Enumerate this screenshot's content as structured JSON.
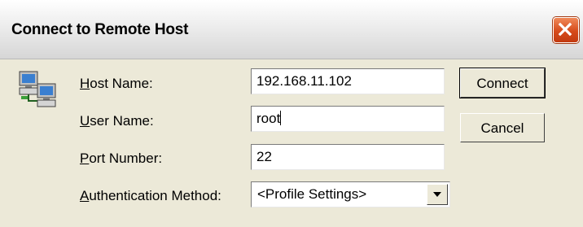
{
  "window": {
    "title": "Connect to Remote Host"
  },
  "form": {
    "host_name_label_acc": "H",
    "host_name_label_rest": "ost Name:",
    "host_name_value": "192.168.11.102",
    "user_name_label_acc": "U",
    "user_name_label_rest": "ser Name:",
    "user_name_value": "root",
    "port_label_acc": "P",
    "port_label_rest": "ort Number:",
    "port_value": "22",
    "auth_label_acc": "A",
    "auth_label_rest": "uthentication Method:",
    "auth_value": "<Profile Settings>"
  },
  "buttons": {
    "connect_label": "Connect",
    "cancel_label": "Cancel"
  },
  "icons": {
    "title_close": "close-icon",
    "hosts": "networked-computers-icon",
    "dropdown": "chevron-down-icon"
  },
  "colors": {
    "close_button": "#d64a1a",
    "dialog_face": "#ece9d8"
  }
}
